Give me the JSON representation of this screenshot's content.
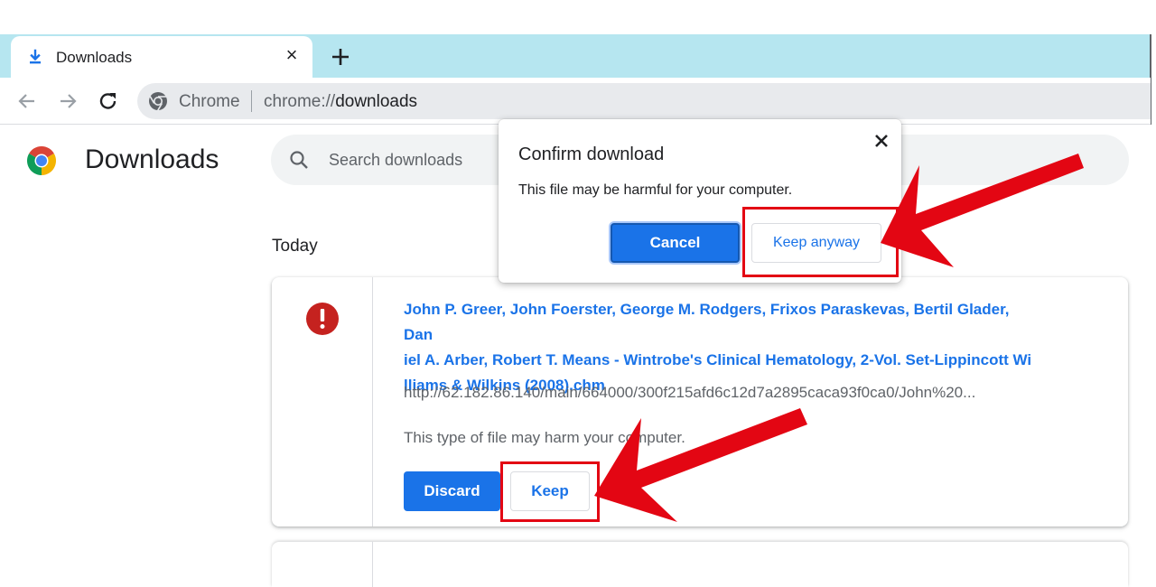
{
  "browser": {
    "tab": {
      "title": "Downloads",
      "close_glyph": "×"
    },
    "omnibox": {
      "site_label": "Chrome",
      "url_scheme": "chrome://",
      "url_path": "downloads"
    },
    "icons": {
      "tab": "download-icon",
      "new_tab": "plus-icon",
      "back": "arrow-left-icon",
      "forward": "arrow-right-icon",
      "reload": "reload-icon",
      "site": "chrome-icon"
    }
  },
  "page": {
    "title": "Downloads",
    "search": {
      "placeholder": "Search downloads",
      "value": ""
    },
    "section": "Today"
  },
  "download": {
    "file_name_lines": [
      "John P. Greer, John Foerster, George M. Rodgers, Frixos Paraskevas, Bertil Glader, Dan",
      "iel A. Arber, Robert T. Means - Wintrobe's Clinical Hematology, 2-Vol. Set-Lippincott Wi",
      "lliams & Wilkins (2008).chm"
    ],
    "url": "http://62.182.86.140/main/664000/300f215afd6c12d7a2895caca93f0ca0/John%20...",
    "warning": "This type of file may harm your computer.",
    "discard_label": "Discard",
    "keep_label": "Keep"
  },
  "dialog": {
    "title": "Confirm download",
    "message": "This file may be harmful for your computer.",
    "cancel_label": "Cancel",
    "keep_anyway_label": "Keep anyway"
  },
  "colors": {
    "accent": "#1a73e8",
    "annotation": "#e30613",
    "tabstrip": "#b6e6f0",
    "warning_icon": "#c5221f"
  }
}
